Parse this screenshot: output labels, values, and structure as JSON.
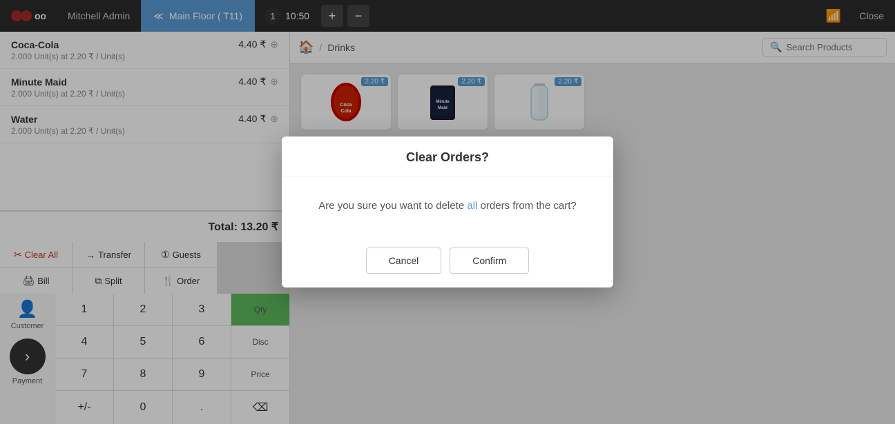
{
  "nav": {
    "logo": "odoo",
    "user": "Mitchell Admin",
    "tab_label": "Main Floor ( T11)",
    "order_number": "1",
    "order_time": "10:50",
    "add_icon": "+",
    "remove_icon": "−",
    "wifi_icon": "📶",
    "close_label": "Close"
  },
  "order": {
    "items": [
      {
        "name": "Coca-Cola",
        "price": "4.40 ₹",
        "detail": "2.000 Unit(s) at 2.20 ₹ / Unit(s)"
      },
      {
        "name": "Minute Maid",
        "price": "4.40 ₹",
        "detail": "2.000 Unit(s) at 2.20 ₹ / Unit(s)"
      },
      {
        "name": "Water",
        "price": "4.40 ₹",
        "detail": "2.000 Unit(s) at 2.20 ₹ / Unit(s)"
      }
    ],
    "total_label": "Total: 13.20 ₹"
  },
  "actions": {
    "clear_all": "Clear All",
    "transfer": "Transfer",
    "guests": "Guests",
    "bill": "Bill",
    "split": "Split",
    "order": "Order"
  },
  "numpad": {
    "customer_label": "Customer",
    "payment_label": "Payment",
    "keys": [
      "1",
      "2",
      "3",
      "Qty",
      "4",
      "5",
      "6",
      "Disc",
      "7",
      "8",
      "9",
      "Price",
      "+/-",
      "0",
      ".",
      "⌫"
    ]
  },
  "products": {
    "home_icon": "🏠",
    "breadcrumb": "Drinks",
    "search_placeholder": "Search Products",
    "items": [
      {
        "name": "Coca-Cola",
        "price": "2.20 ₹",
        "emoji": "🥤"
      },
      {
        "name": "Minute Maid",
        "price": "2.20 ₹",
        "emoji": "🧃"
      },
      {
        "name": "Water",
        "price": "2.20 ₹",
        "emoji": "💧"
      }
    ]
  },
  "dialog": {
    "title": "Clear Orders?",
    "message_before": "Are you sure you want to delete ",
    "message_highlight": "all",
    "message_after": " orders from the cart?",
    "cancel_label": "Cancel",
    "confirm_label": "Confirm"
  }
}
